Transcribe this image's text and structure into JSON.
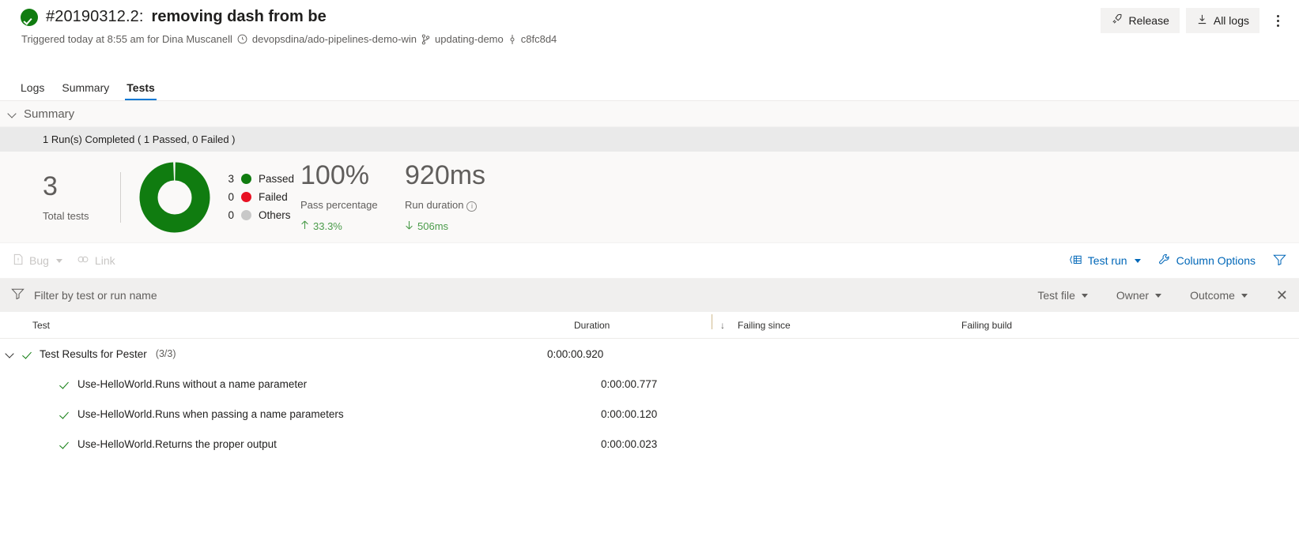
{
  "header": {
    "status_icon": "check-circle-icon",
    "build_number": "#20190312.2:",
    "build_title": "removing dash from be",
    "triggered_text": "Triggered today at 8:55 am for Dina Muscanell",
    "repo_icon": "github-icon",
    "repo": "devopsdina/ado-pipelines-demo-win",
    "branch_icon": "branch-icon",
    "branch": "updating-demo",
    "commit_icon": "commit-icon",
    "commit": "c8fc8d4",
    "release_button": "Release",
    "release_icon": "rocket-icon",
    "all_logs_button": "All logs",
    "all_logs_icon": "download-icon",
    "more_icon": "more-vertical-icon"
  },
  "tabs": [
    {
      "label": "Logs",
      "active": false
    },
    {
      "label": "Summary",
      "active": false
    },
    {
      "label": "Tests",
      "active": true
    }
  ],
  "summary": {
    "section_label": "Summary",
    "collapse_icon": "chevron-down-icon",
    "runs_text": "1 Run(s) Completed ( 1 Passed, 0 Failed )",
    "total_tests_value": "3",
    "total_tests_label": "Total tests",
    "pass_percentage_value": "100%",
    "pass_percentage_label": "Pass percentage",
    "pass_percentage_trend": "33.3%",
    "pass_percentage_trend_dir": "up",
    "run_duration_value": "920ms",
    "run_duration_label": "Run duration",
    "run_duration_info_icon": "info-icon",
    "run_duration_trend": "506ms",
    "run_duration_trend_dir": "down"
  },
  "chart_data": {
    "type": "pie",
    "title": "Test outcome distribution",
    "categories": [
      "Passed",
      "Failed",
      "Others"
    ],
    "values": [
      3,
      0,
      0
    ],
    "colors": [
      "#107C10",
      "#E81123",
      "#C8C8C8"
    ],
    "legend": [
      {
        "count": "3",
        "label": "Passed",
        "color": "#107C10"
      },
      {
        "count": "0",
        "label": "Failed",
        "color": "#E81123"
      },
      {
        "count": "0",
        "label": "Others",
        "color": "#C8C8C8"
      }
    ],
    "donut": true,
    "legend_position": "right"
  },
  "toolbar": {
    "bug_label": "Bug",
    "bug_icon": "bug-work-item-icon",
    "bug_disabled": true,
    "link_label": "Link",
    "link_icon": "link-icon",
    "link_disabled": true,
    "test_run_label": "Test run",
    "test_run_icon": "test-run-icon",
    "column_options_label": "Column Options",
    "column_options_icon": "wrench-icon",
    "filter_icon": "filter-icon"
  },
  "filterbar": {
    "filter_icon": "filter-icon",
    "placeholder": "Filter by test or run name",
    "value": "",
    "dropdowns": [
      {
        "label": "Test file"
      },
      {
        "label": "Owner"
      },
      {
        "label": "Outcome"
      }
    ],
    "close_icon": "close-icon"
  },
  "table": {
    "columns": {
      "test": "Test",
      "duration": "Duration",
      "sort_icon": "sort-descending-icon",
      "failing_since": "Failing since",
      "failing_build": "Failing build"
    },
    "rows": [
      {
        "type": "group",
        "name": "Test Results for Pester",
        "count": "(3/3)",
        "duration": "0:00:00.920",
        "failing_since": "",
        "failing_build": "",
        "expanded": true,
        "outcome": "passed"
      },
      {
        "type": "child",
        "name": "Use-HelloWorld.Runs without a name parameter",
        "duration": "0:00:00.777",
        "failing_since": "",
        "failing_build": "",
        "outcome": "passed"
      },
      {
        "type": "child",
        "name": "Use-HelloWorld.Runs when passing a name parameters",
        "duration": "0:00:00.120",
        "failing_since": "",
        "failing_build": "",
        "outcome": "passed"
      },
      {
        "type": "child",
        "name": "Use-HelloWorld.Returns the proper output",
        "duration": "0:00:00.023",
        "failing_since": "",
        "failing_build": "",
        "outcome": "passed"
      }
    ]
  },
  "colors": {
    "accent": "#0078d4",
    "link": "#0067b8",
    "passed": "#107C10",
    "failed": "#E81123",
    "others": "#C8C8C8",
    "trend_green": "#4a9b4a"
  }
}
